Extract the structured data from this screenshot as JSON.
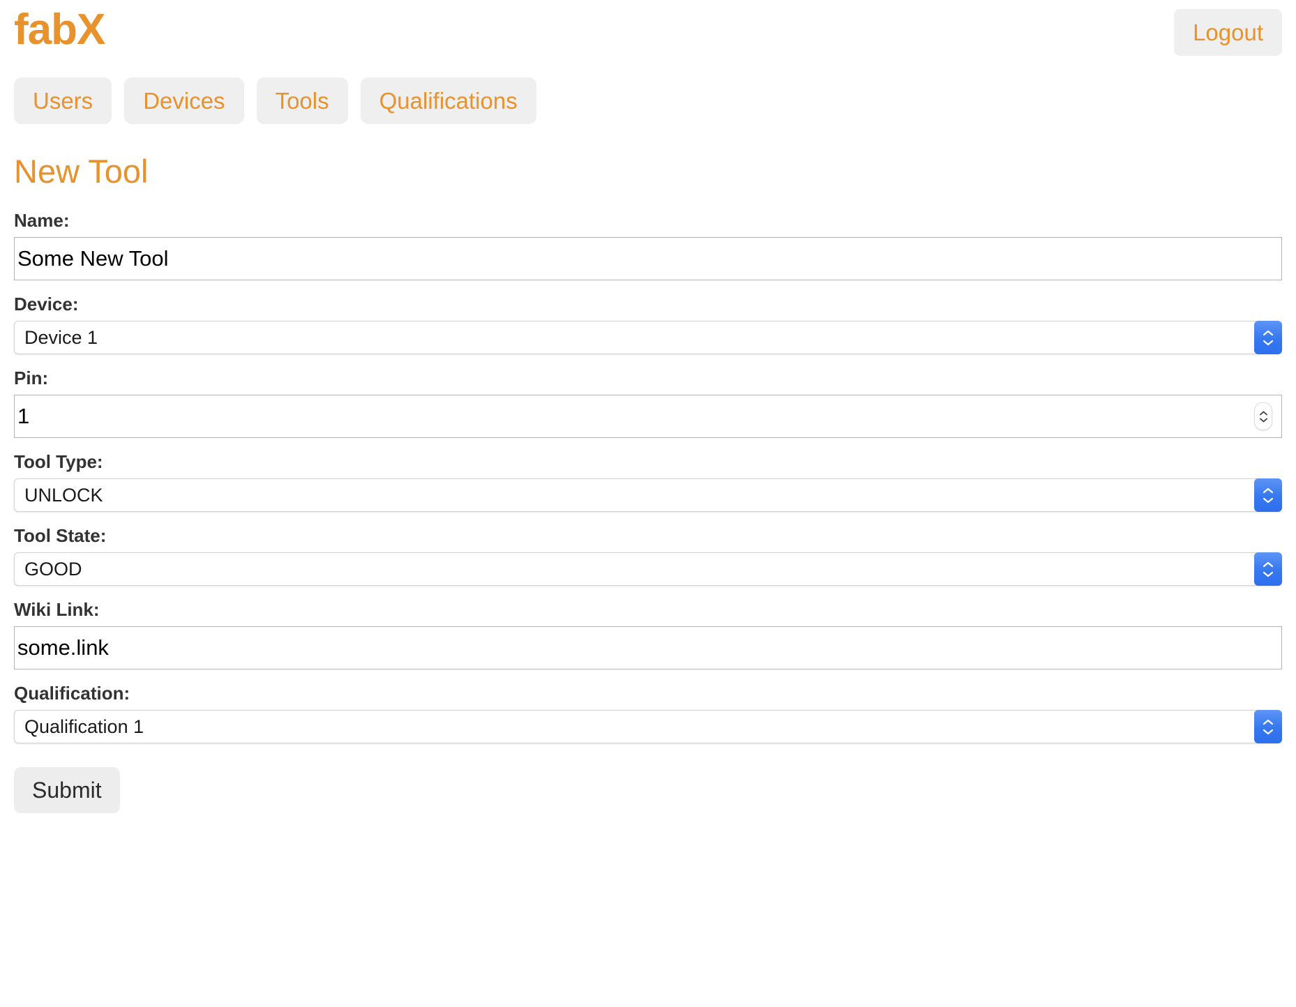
{
  "header": {
    "brand": "fabX",
    "logout_label": "Logout"
  },
  "nav": {
    "tabs": [
      {
        "label": "Users",
        "name": "users"
      },
      {
        "label": "Devices",
        "name": "devices"
      },
      {
        "label": "Tools",
        "name": "tools"
      },
      {
        "label": "Qualifications",
        "name": "qualifications"
      }
    ]
  },
  "page": {
    "title": "New Tool"
  },
  "form": {
    "name": {
      "label": "Name:",
      "value": "Some New Tool",
      "placeholder": ""
    },
    "device": {
      "label": "Device:",
      "value": "Device 1"
    },
    "pin": {
      "label": "Pin:",
      "value": "1",
      "placeholder": ""
    },
    "tool_type": {
      "label": "Tool Type:",
      "value": "UNLOCK"
    },
    "tool_state": {
      "label": "Tool State:",
      "value": "GOOD"
    },
    "wiki_link": {
      "label": "Wiki Link:",
      "value": "some.link",
      "placeholder": ""
    },
    "qualification": {
      "label": "Qualification:",
      "value": "Qualification 1"
    },
    "submit_label": "Submit"
  },
  "colors": {
    "accent_orange": "#E8922E",
    "button_grey": "#EFEFEF",
    "label_dark": "#333333",
    "stepper_blue": "#3578F0",
    "input_border": "#B3B3B3"
  }
}
